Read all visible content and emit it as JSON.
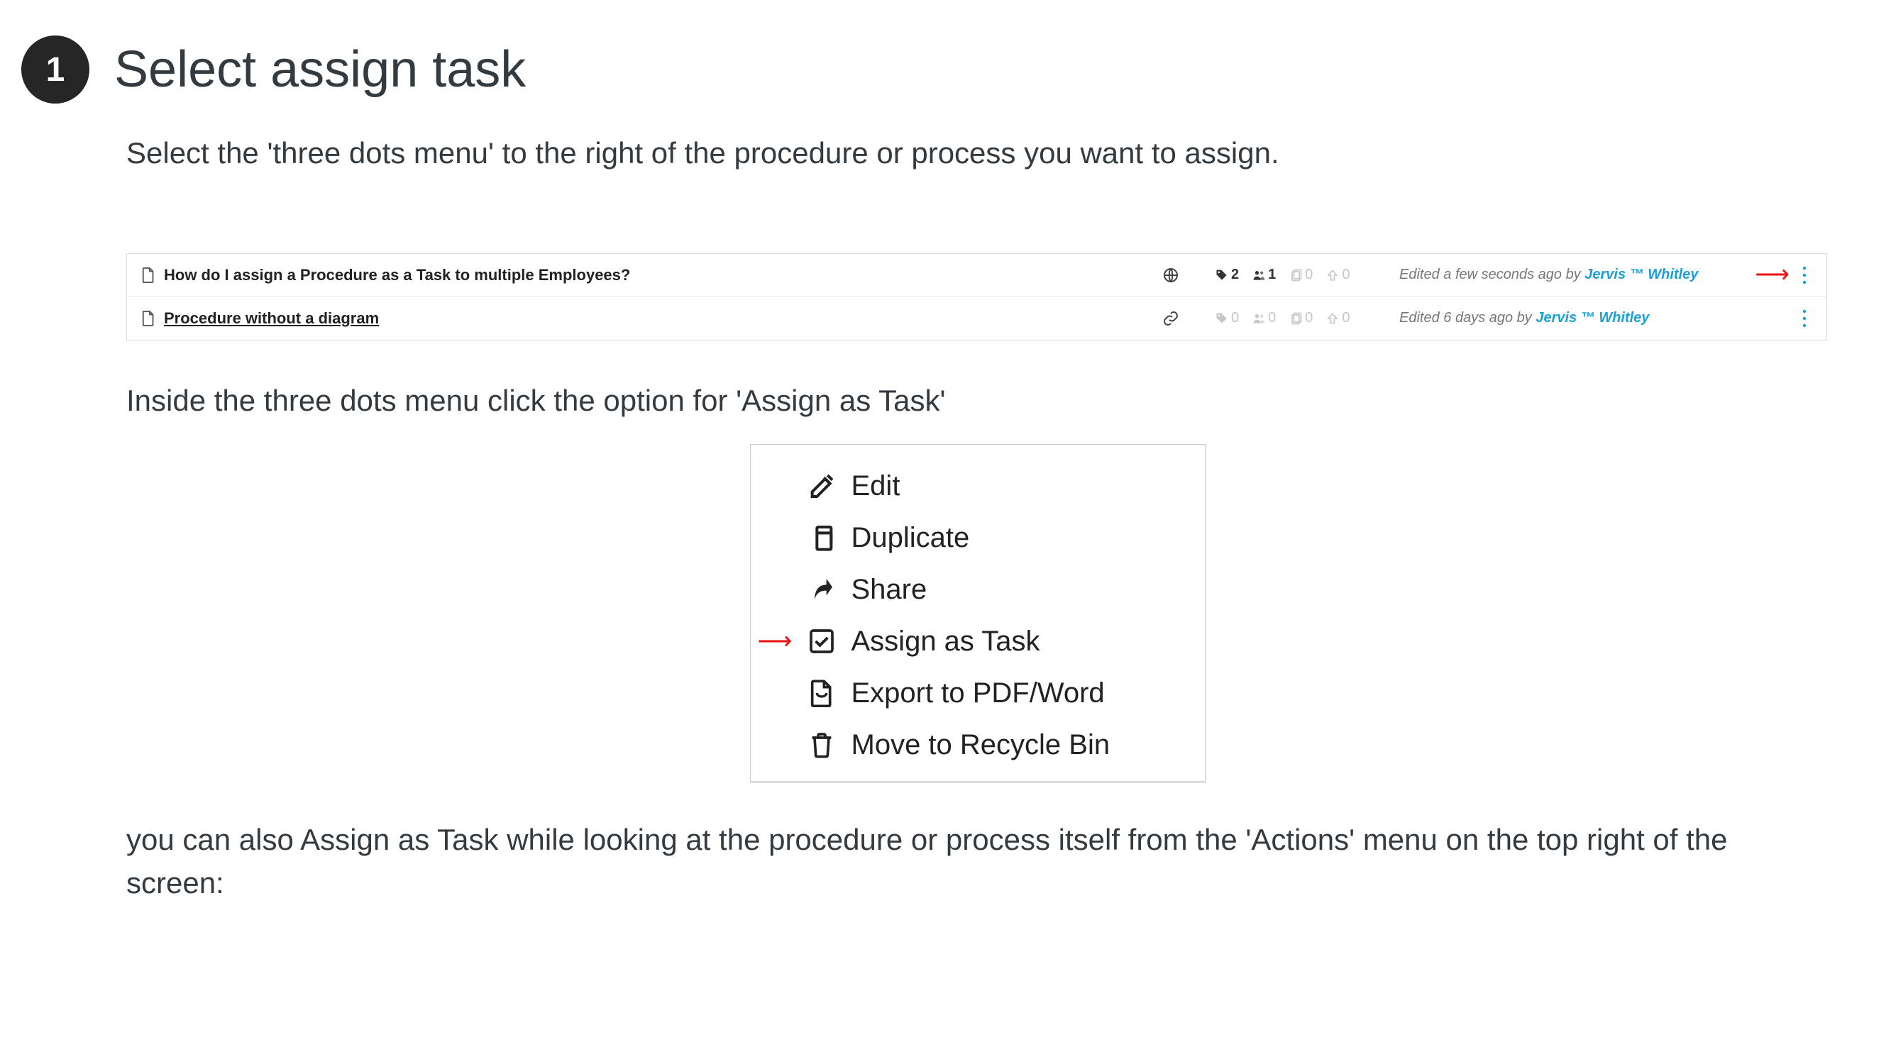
{
  "step": {
    "number": "1",
    "title": "Select assign task"
  },
  "paragraphs": {
    "p1": "Select the 'three dots menu' to the right of the procedure or process you want to assign.",
    "p2": "Inside the three dots menu click the option for 'Assign as Task'",
    "p3": "you can also Assign as Task while looking at the procedure or process itself from the 'Actions' menu on the top right of the screen:"
  },
  "list": {
    "rows": [
      {
        "title": "How do I assign a Procedure as a Task to multiple Employees?",
        "visibility_icon": "globe",
        "stats": {
          "tags": {
            "value": "2",
            "dim": false
          },
          "users": {
            "value": "1",
            "dim": false
          },
          "files": {
            "value": "0",
            "dim": true
          },
          "up": {
            "value": "0",
            "dim": true
          }
        },
        "meta_prefix": "Edited a few seconds ago by ",
        "author": "Jervis ™ Whitley",
        "show_arrow": true
      },
      {
        "title": " Procedure without a diagram",
        "title_underlined": true,
        "visibility_icon": "link",
        "stats": {
          "tags": {
            "value": "0",
            "dim": true
          },
          "users": {
            "value": "0",
            "dim": true
          },
          "files": {
            "value": "0",
            "dim": true
          },
          "up": {
            "value": "0",
            "dim": true
          }
        },
        "meta_prefix": "Edited 6 days ago by ",
        "author": "Jervis ™ Whitley",
        "show_arrow": false
      }
    ]
  },
  "menu": {
    "items": [
      {
        "icon": "edit",
        "label": "Edit"
      },
      {
        "icon": "copy",
        "label": "Duplicate"
      },
      {
        "icon": "share",
        "label": "Share"
      },
      {
        "icon": "check",
        "label": "Assign as Task",
        "highlight_arrow": true
      },
      {
        "icon": "file-pdf",
        "label": "Export to PDF/Word"
      },
      {
        "icon": "trash",
        "label": "Move to Recycle Bin"
      }
    ]
  }
}
